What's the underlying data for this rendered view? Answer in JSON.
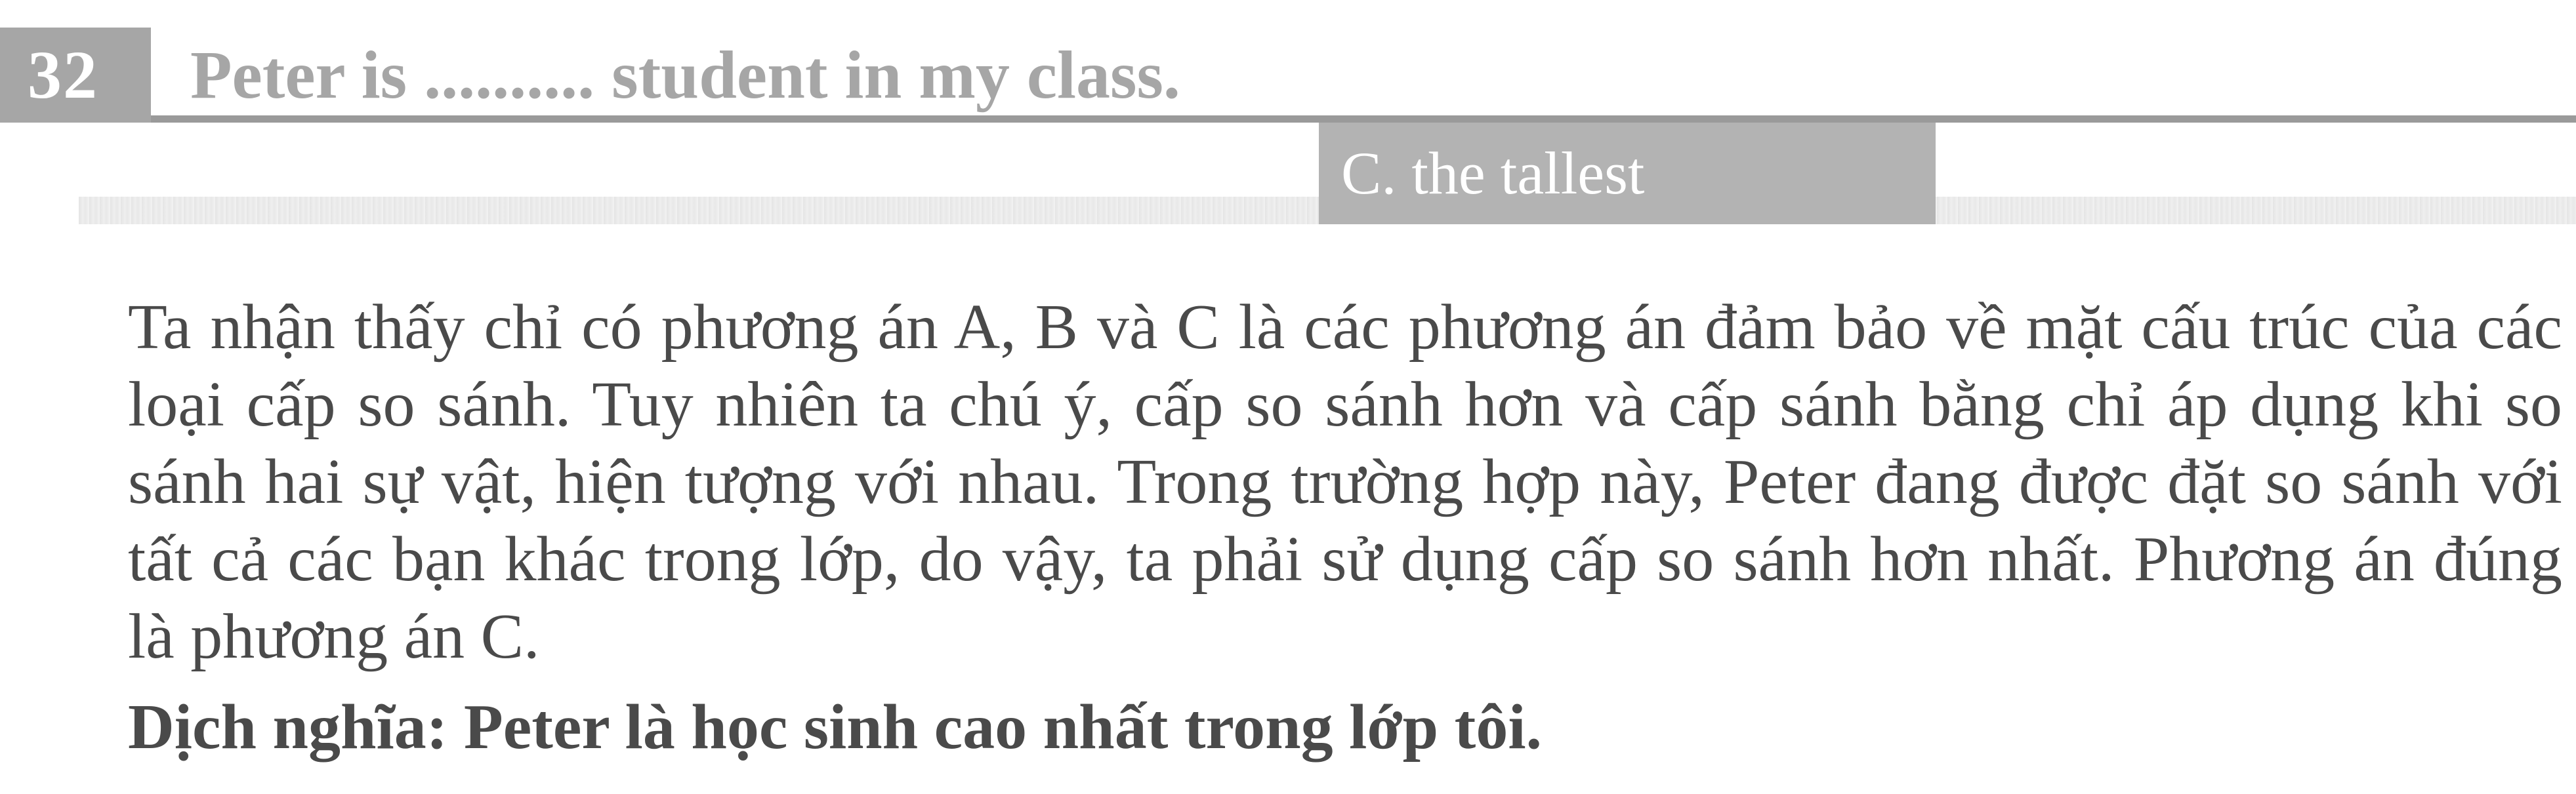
{
  "question": {
    "number": "32",
    "text": "Peter is .......... student in my class."
  },
  "answer": {
    "label": "C. the tallest"
  },
  "explanation": {
    "paragraph": "Ta nhận thấy chỉ có phương án A, B và C là các phương án đảm bảo về mặt cấu trúc của các loại cấp so sánh. Tuy nhiên ta chú ý, cấp so sánh hơn và cấp sánh bằng chỉ áp dụng khi so sánh hai sự vật, hiện tượng với nhau. Trong trường hợp này, Peter đang được đặt so sánh với tất cả các bạn khác trong lớp, do vậy, ta phải sử dụng cấp so sánh hơn nhất. Phương án đúng là phương án C."
  },
  "translation": {
    "text": "Dịch nghĩa: Peter là học sinh cao nhất trong lớp tôi."
  }
}
